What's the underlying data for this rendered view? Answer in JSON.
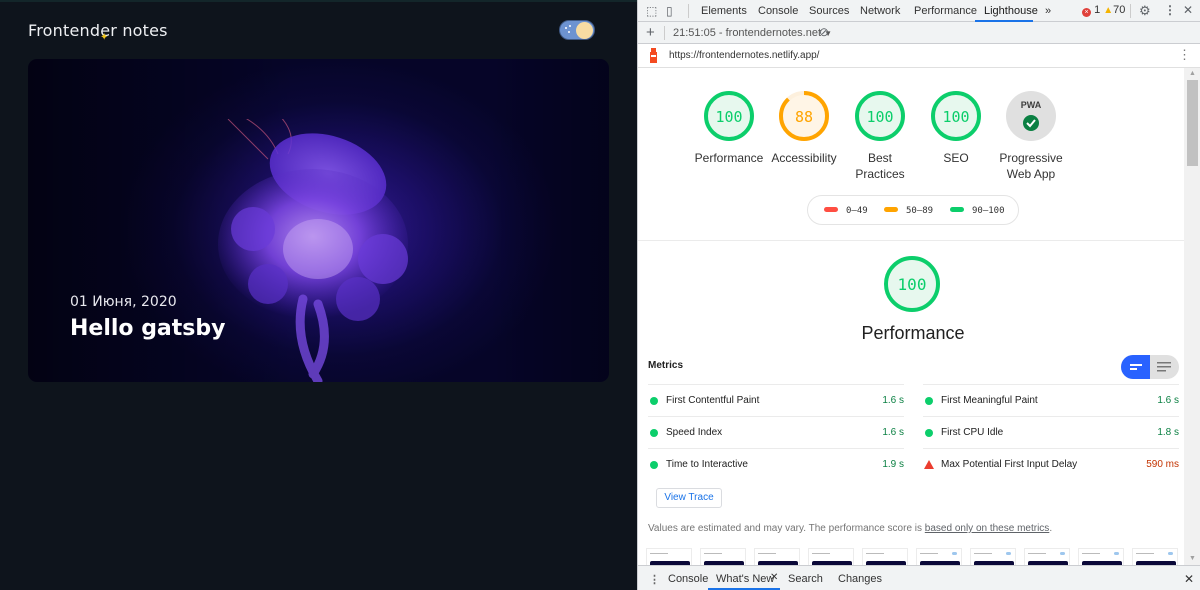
{
  "site": {
    "title": "Frontender notes",
    "theme_toggle_state": "dark",
    "post": {
      "date": "01 Июня, 2020",
      "title": "Hello gatsby",
      "image_subject": "jellyfish"
    }
  },
  "devtools": {
    "tabs": [
      {
        "label": "Elements",
        "active": false
      },
      {
        "label": "Console",
        "active": false
      },
      {
        "label": "Sources",
        "active": false
      },
      {
        "label": "Network",
        "active": false
      },
      {
        "label": "Performance",
        "active": false
      },
      {
        "label": "Lighthouse",
        "active": true
      }
    ],
    "more_tabs": "»",
    "errors": "1",
    "warnings": "70",
    "report_selector": "21:51:05 - frontendernotes.net",
    "url": "https://frontendernotes.netlify.app/",
    "drawer_tabs": [
      {
        "label": "Console",
        "active": false
      },
      {
        "label": "What's New",
        "active": true,
        "closable": true
      },
      {
        "label": "Search",
        "active": false
      },
      {
        "label": "Changes",
        "active": false
      }
    ]
  },
  "lighthouse": {
    "colors": {
      "pass": "#0cce6b",
      "average": "#ffa400",
      "fail": "#ff4e42"
    },
    "categories": [
      {
        "label": "Performance",
        "score": 100,
        "rating": "pass"
      },
      {
        "label": "Accessibility",
        "score": 88,
        "rating": "average"
      },
      {
        "label": "Best Practices",
        "score": 100,
        "rating": "pass"
      },
      {
        "label": "SEO",
        "score": 100,
        "rating": "pass"
      },
      {
        "label": "Progressive Web App",
        "badge": "PWA",
        "rating": "pwa-check"
      }
    ],
    "legend": [
      {
        "range": "0–49",
        "color": "#ff4e42"
      },
      {
        "range": "50–89",
        "color": "#ffa400"
      },
      {
        "range": "90–100",
        "color": "#0cce6b"
      }
    ],
    "section": {
      "title": "Performance",
      "score": 100
    },
    "metrics_heading": "Metrics",
    "metrics_left": [
      {
        "name": "First Contentful Paint",
        "value": "1.6 s",
        "status": "pass"
      },
      {
        "name": "Speed Index",
        "value": "1.6 s",
        "status": "pass"
      },
      {
        "name": "Time to Interactive",
        "value": "1.9 s",
        "status": "pass"
      }
    ],
    "metrics_right": [
      {
        "name": "First Meaningful Paint",
        "value": "1.6 s",
        "status": "pass"
      },
      {
        "name": "First CPU Idle",
        "value": "1.8 s",
        "status": "pass"
      },
      {
        "name": "Max Potential First Input Delay",
        "value": "590 ms",
        "status": "fail"
      }
    ],
    "view_trace": "View Trace",
    "note_text": "Values are estimated and may vary. The performance score is ",
    "note_link": "based only on these metrics",
    "note_end": ".",
    "filmstrip_frames": 10
  }
}
